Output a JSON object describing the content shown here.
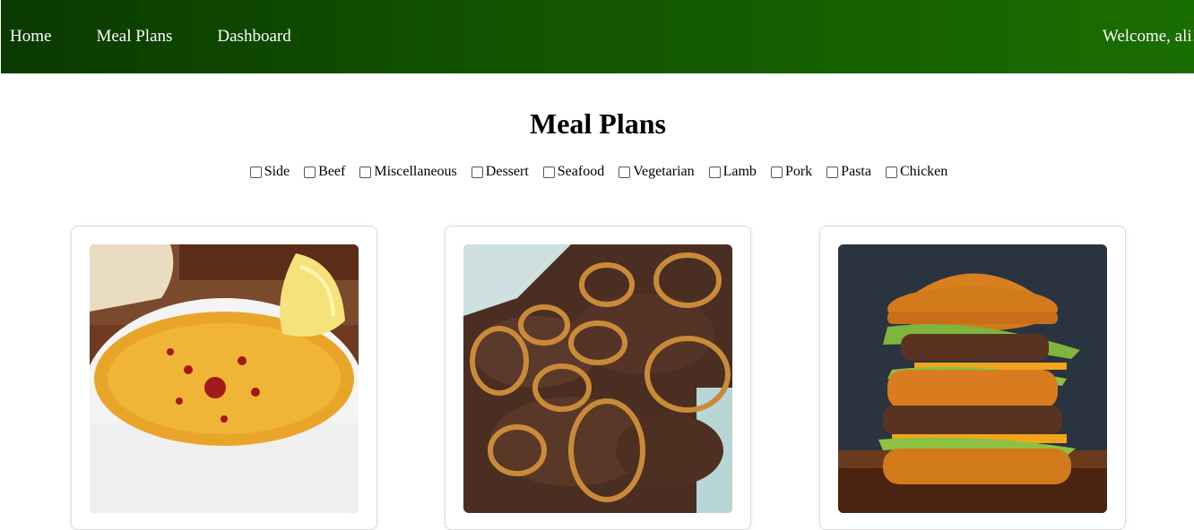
{
  "nav": {
    "links": [
      "Home",
      "Meal Plans",
      "Dashboard"
    ],
    "welcome": "Welcome, ali!"
  },
  "page": {
    "title": "Meal Plans"
  },
  "filters": [
    "Side",
    "Beef",
    "Miscellaneous",
    "Dessert",
    "Seafood",
    "Vegetarian",
    "Lamb",
    "Pork",
    "Pasta",
    "Chicken"
  ],
  "colors": {
    "nav_dark": "#0a3a00",
    "nav_light": "#1a6e00",
    "nav_text": "#ffffff"
  }
}
